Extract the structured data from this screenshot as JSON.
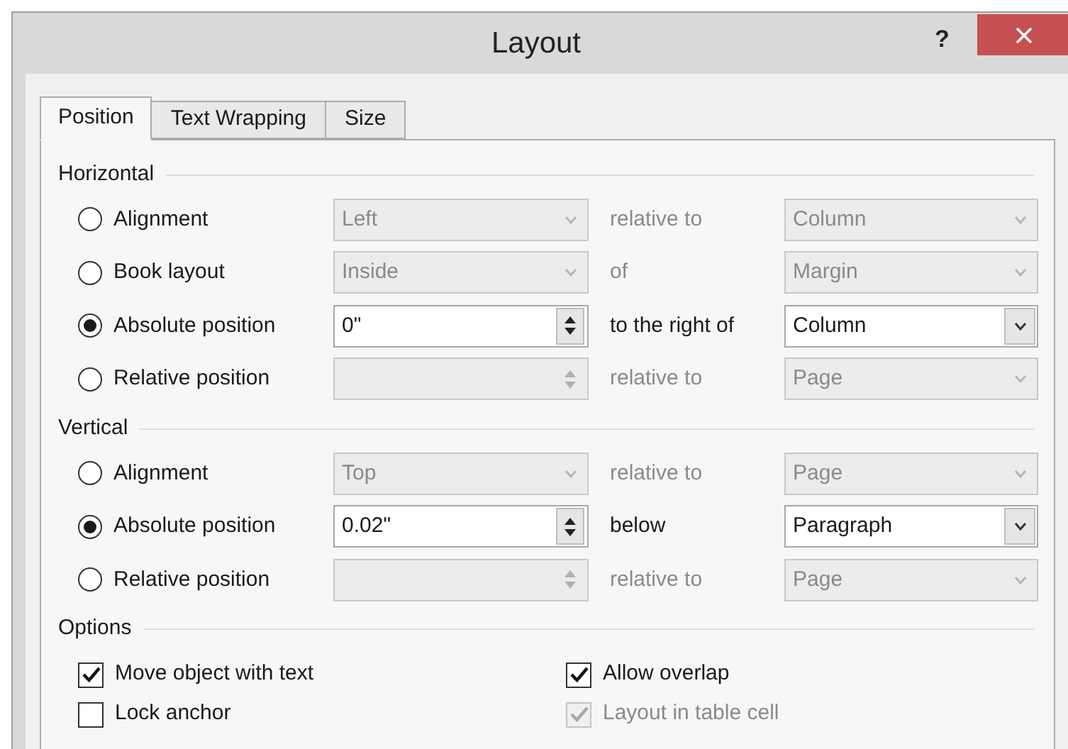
{
  "window": {
    "title": "Layout",
    "help": "?"
  },
  "tabs": [
    {
      "label": "Position",
      "selected": true
    },
    {
      "label": "Text Wrapping",
      "selected": false
    },
    {
      "label": "Size",
      "selected": false
    }
  ],
  "sections": [
    {
      "title": "Horizontal",
      "kind": "radio_rows",
      "rows": [
        {
          "label": "Alignment",
          "selected": false,
          "field": {
            "kind": "dropdown",
            "value": "Left",
            "disabled": true
          },
          "relation": {
            "text": "relative to",
            "disabled": true
          },
          "reference": {
            "kind": "dropdown",
            "value": "Column",
            "disabled": true
          }
        },
        {
          "label": "Book layout",
          "selected": false,
          "field": {
            "kind": "dropdown",
            "value": "Inside",
            "disabled": true
          },
          "relation": {
            "text": "of",
            "disabled": true
          },
          "reference": {
            "kind": "dropdown",
            "value": "Margin",
            "disabled": true
          }
        },
        {
          "label": "Absolute position",
          "selected": true,
          "field": {
            "kind": "spin",
            "value": "0\"",
            "disabled": false
          },
          "relation": {
            "text": "to the right of",
            "disabled": false
          },
          "reference": {
            "kind": "dropdown",
            "value": "Column",
            "disabled": false
          }
        },
        {
          "label": "Relative position",
          "selected": false,
          "field": {
            "kind": "spin",
            "disabled": true
          },
          "relation": {
            "text": "relative to",
            "disabled": true
          },
          "reference": {
            "kind": "dropdown",
            "value": "Page",
            "disabled": true
          }
        }
      ]
    },
    {
      "title": "Vertical",
      "kind": "radio_rows",
      "rows": [
        {
          "label": "Alignment",
          "selected": false,
          "field": {
            "kind": "dropdown",
            "value": "Top",
            "disabled": true
          },
          "relation": {
            "text": "relative to",
            "disabled": true
          },
          "reference": {
            "kind": "dropdown",
            "value": "Page",
            "disabled": true
          }
        },
        {
          "label": "Absolute position",
          "selected": true,
          "field": {
            "kind": "spin",
            "value": "0.02\"",
            "disabled": false
          },
          "relation": {
            "text": "below",
            "disabled": false
          },
          "reference": {
            "kind": "dropdown",
            "value": "Paragraph",
            "disabled": false
          }
        },
        {
          "label": "Relative position",
          "selected": false,
          "field": {
            "kind": "spin",
            "disabled": true
          },
          "relation": {
            "text": "relative to",
            "disabled": true
          },
          "reference": {
            "kind": "dropdown",
            "value": "Page",
            "disabled": true
          }
        }
      ]
    },
    {
      "title": "Options",
      "kind": "checkbox_grid",
      "items": [
        {
          "label": "Move object with text",
          "checked": true,
          "disabled": false
        },
        {
          "label": "Allow overlap",
          "checked": true,
          "disabled": false
        },
        {
          "label": "Lock anchor",
          "checked": false,
          "disabled": false
        },
        {
          "label": "Layout in table cell",
          "checked": true,
          "disabled": true
        }
      ]
    }
  ]
}
